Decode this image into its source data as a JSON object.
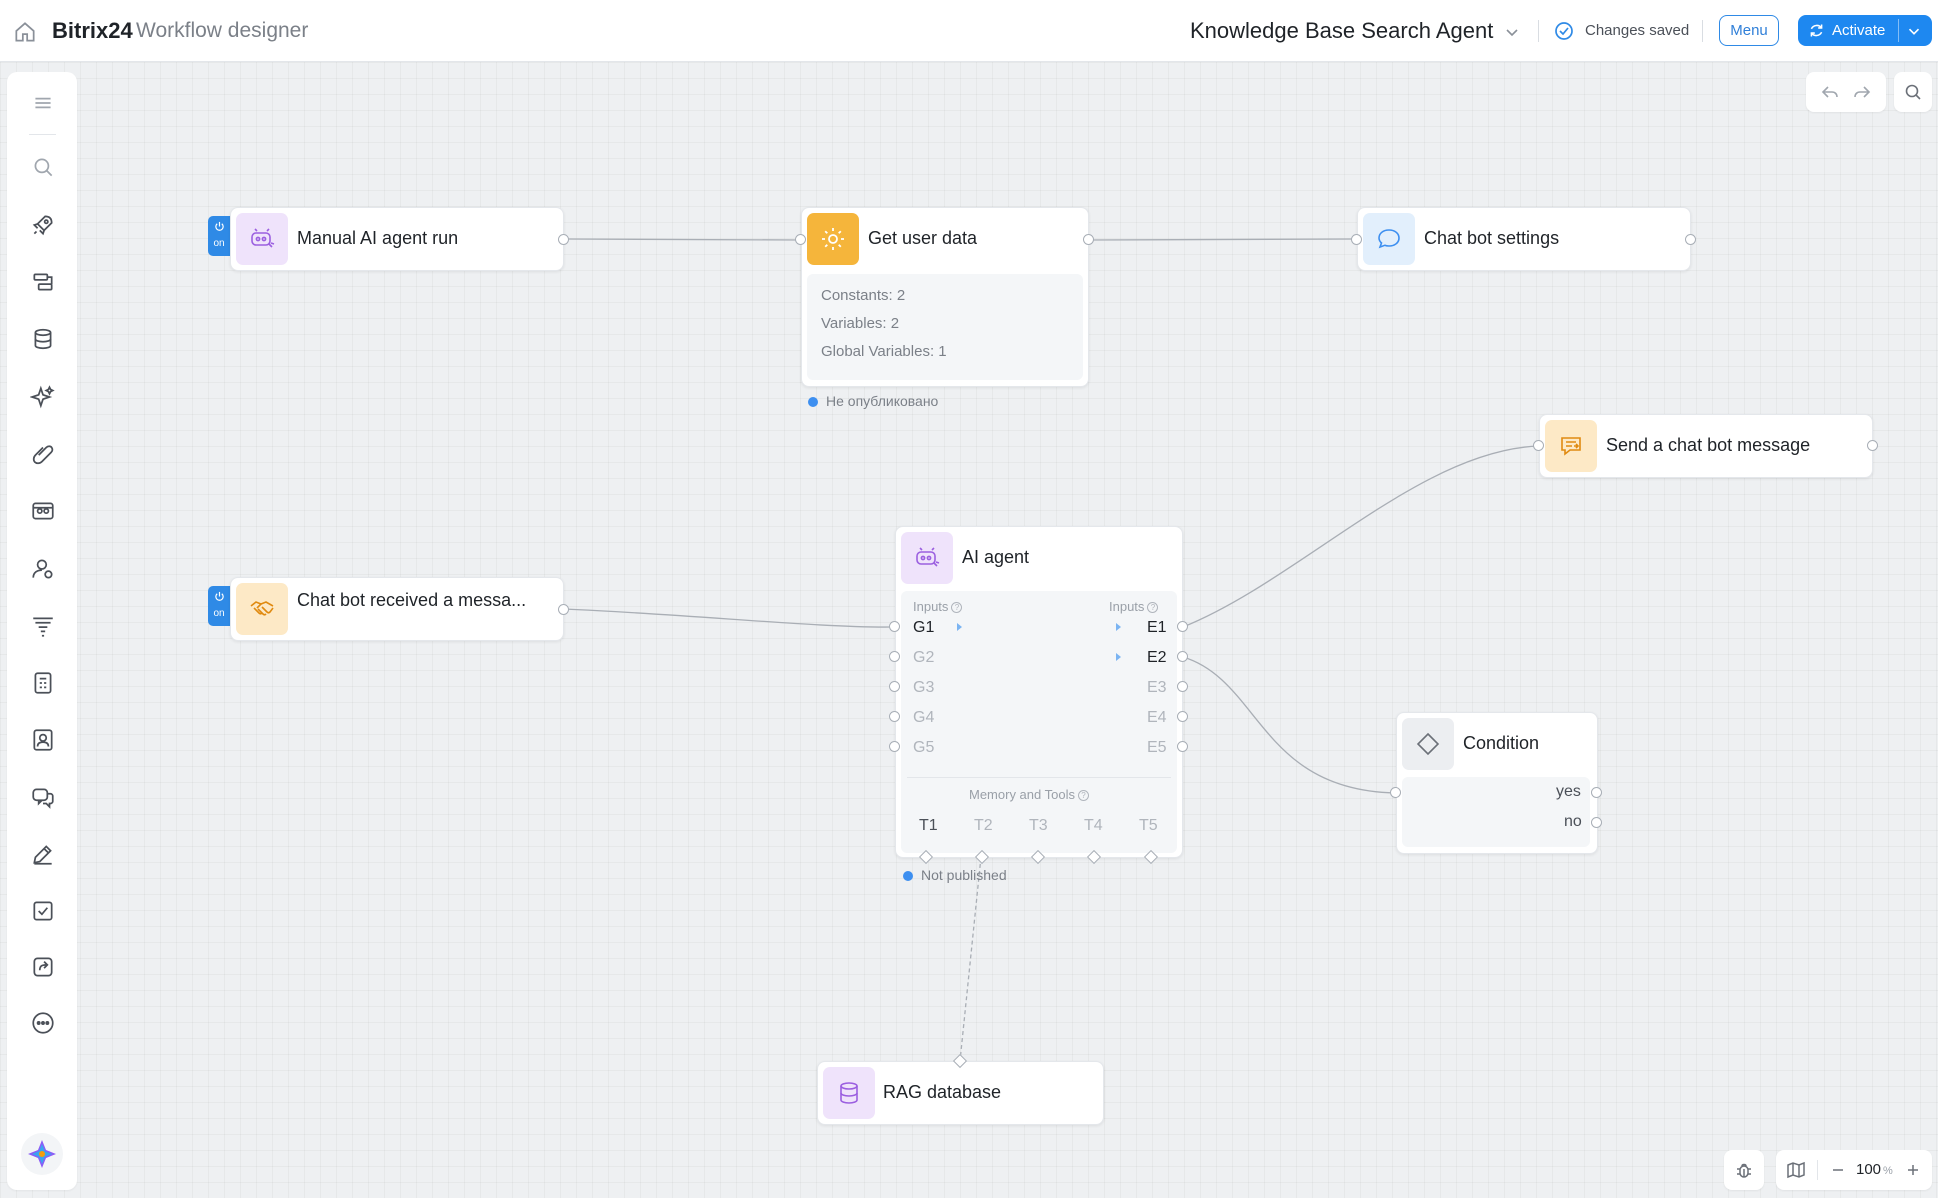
{
  "header": {
    "brand": "Bitrix24",
    "subtitle": "Workflow designer",
    "workflow_title": "Knowledge Base Search Agent",
    "status_text": "Changes saved",
    "menu_label": "Menu",
    "activate_label": "Activate"
  },
  "sidebar": {
    "items": [
      "menu-icon",
      "search-icon",
      "rocket-icon",
      "blocks-icon",
      "database-icon",
      "sparkles-icon",
      "paperclip-icon",
      "robot-grid-icon",
      "user-settings-icon",
      "filter-icon",
      "calculator-icon",
      "contact-card-icon",
      "chat-icon",
      "pen-icon",
      "checkbox-icon",
      "share-icon",
      "more-icon"
    ]
  },
  "nodes": {
    "manual_run": {
      "title": "Manual AI agent run",
      "badge": "on"
    },
    "get_user_data": {
      "title": "Get user data",
      "lines": [
        "Constants: 2",
        "Variables: 2",
        "Global Variables: 1"
      ],
      "status": "Не опубликовано"
    },
    "chatbot_settings": {
      "title": "Chat bot settings"
    },
    "send_message": {
      "title": "Send a chat bot message"
    },
    "chatbot_received": {
      "title": "Chat bot received a messa...",
      "badge": "on"
    },
    "ai_agent": {
      "title": "AI agent",
      "inputs_left_label": "Inputs",
      "inputs_right_label": "Inputs",
      "left_ports": [
        "G1",
        "G2",
        "G3",
        "G4",
        "G5"
      ],
      "right_ports": [
        "E1",
        "E2",
        "E3",
        "E4",
        "E5"
      ],
      "memory_label": "Memory and Tools",
      "tools": [
        "T1",
        "T2",
        "T3",
        "T4",
        "T5"
      ],
      "status": "Not published"
    },
    "condition": {
      "title": "Condition",
      "yes": "yes",
      "no": "no"
    },
    "rag": {
      "title": "RAG database"
    }
  },
  "zoom": {
    "value": "100",
    "unit": "%"
  },
  "colors": {
    "accent": "#1e88f0",
    "purple_icon_bg": "#efe3fb",
    "orange_icon_bg": "#fde9c6",
    "gear_bg": "#f5b53b",
    "blue_icon_bg": "#e2effc"
  }
}
